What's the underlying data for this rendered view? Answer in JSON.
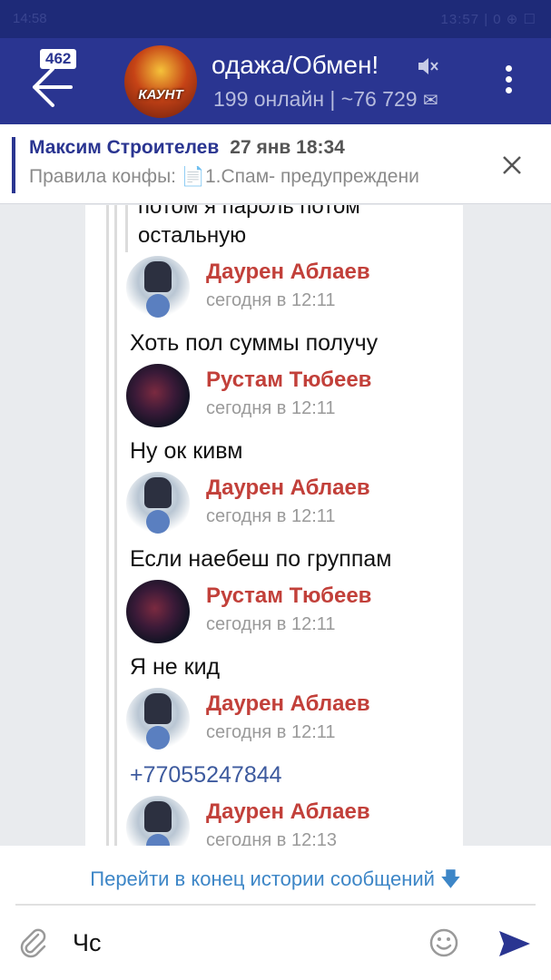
{
  "status": {
    "left": "14:58",
    "right": "13:57 | 0 ⊕ ☐"
  },
  "header": {
    "unread_count": "462",
    "chat_avatar_label": "КАУНТ",
    "title": "одажа/Обмен!",
    "subtitle": "199 онлайн | ~76 729",
    "mute_icon": "mute-icon",
    "mail_icon": "✉"
  },
  "pinned": {
    "author": "Максим Строителев",
    "date": "27 янв 18:34",
    "text": "Правила конфы: 📄1.Спам- предупреждени"
  },
  "quote": {
    "line1": "потом я пароль потом",
    "line2": "остальную"
  },
  "messages": [
    {
      "author": "Даурен Аблаев",
      "time": "сегодня в 12:11",
      "text": "Хоть пол суммы получу"
    },
    {
      "author": "Рустам Тюбеев",
      "time": "сегодня в 12:11",
      "text": "Ну ок кивм"
    },
    {
      "author": "Даурен Аблаев",
      "time": "сегодня в 12:11",
      "text": "Если наебеш по группам"
    },
    {
      "author": "Рустам Тюбеев",
      "time": "сегодня в 12:11",
      "text": "Я не кид"
    },
    {
      "author": "Даурен Аблаев",
      "time": "сегодня в 12:11",
      "text": "+77055247844"
    },
    {
      "author": "Даурен Аблаев",
      "time": "сегодня в 12:13",
      "text": ""
    }
  ],
  "footer": {
    "jump_label": "Перейти в конец истории сообщений",
    "jump_arrow": "🡇",
    "input_value": "Чс"
  },
  "colors": {
    "header": "#2a3591",
    "name": "#c2403a",
    "link": "#3d86c7"
  }
}
